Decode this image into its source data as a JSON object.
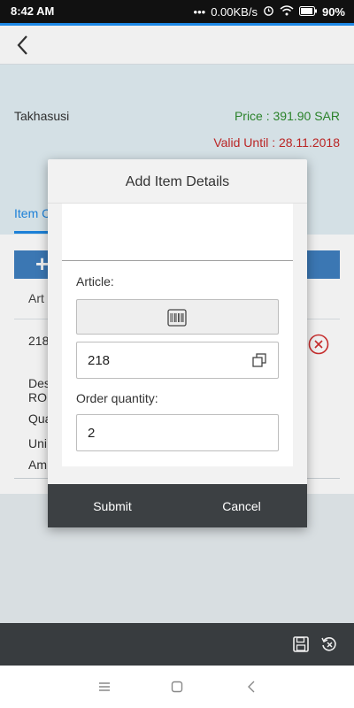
{
  "status_bar": {
    "time": "8:42 AM",
    "network_speed": "0.00KB/s",
    "battery": "90%",
    "icons": [
      "dots-icon",
      "alarm-icon",
      "wifi-icon",
      "battery-icon"
    ]
  },
  "header": {
    "back_icon": "back-arrow-icon"
  },
  "info": {
    "company": "Takhasusi",
    "price": "Price : 391.90 SAR",
    "valid_until": "Valid Until : 28.11.2018",
    "tab_label": "Item C"
  },
  "list": {
    "add_symbol": "+",
    "column_article": "Art",
    "row": {
      "article_number": "218",
      "field1": "Des",
      "field1b": "RO",
      "field2": "Qua",
      "field3": "Uni",
      "field4": "Am"
    }
  },
  "dialog": {
    "title": "Add Item Details",
    "article_label": "Article:",
    "article_value": "218",
    "quantity_label": "Order quantity:",
    "quantity_value": "2",
    "submit_label": "Submit",
    "cancel_label": "Cancel"
  },
  "colors": {
    "accent": "#1e88e5",
    "price": "#2e8b2e",
    "valid_until": "#c62828",
    "add_bar": "#3f7fbf",
    "dark_bar": "#3c4043"
  }
}
